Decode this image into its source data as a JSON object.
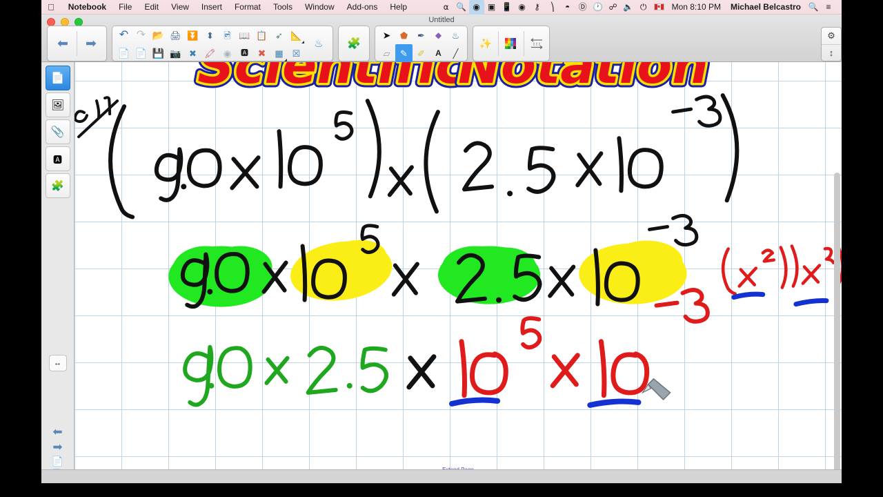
{
  "menubar": {
    "apple_icon": "apple-icon",
    "items": [
      {
        "label": "Notebook",
        "bold": true
      },
      {
        "label": "File",
        "bold": false
      },
      {
        "label": "Edit",
        "bold": false
      },
      {
        "label": "View",
        "bold": false
      },
      {
        "label": "Insert",
        "bold": false
      },
      {
        "label": "Format",
        "bold": false
      },
      {
        "label": "Tools",
        "bold": false
      },
      {
        "label": "Window",
        "bold": false
      },
      {
        "label": "Add-ons",
        "bold": false
      },
      {
        "label": "Help",
        "bold": false
      }
    ],
    "status_icons": [
      "do-not-disturb-icon",
      "spotlight-dark-icon",
      "screen-recording-icon",
      "display-icon",
      "device-sync-icon",
      "time-machine-icon",
      "airplay-audio-icon",
      "airplay-display-icon",
      "wifi-icon",
      "accessibility-icon",
      "clock-history-icon",
      "bluetooth-icon",
      "volume-icon",
      "battery-icon"
    ],
    "flag_label": "CA",
    "clock": "Mon 8:10 PM",
    "user": "Michael Belcastro",
    "search_icon": "search-icon",
    "notification_icon": "notification-center-icon"
  },
  "window": {
    "document_title": "Untitled",
    "traffic_lights": [
      "close-button",
      "minimize-button",
      "zoom-button"
    ]
  },
  "toolbar": {
    "nav": [
      {
        "name": "previous-page-button",
        "glyph": "⬅"
      },
      {
        "name": "next-page-button",
        "glyph": "➡"
      }
    ],
    "group_main_row1": [
      {
        "name": "undo-button",
        "glyph": "↶",
        "color": "#2f6fa8"
      },
      {
        "name": "redo-button",
        "glyph": "↷",
        "color": "#a8b8c4"
      },
      {
        "name": "open-file-button",
        "glyph": "📂",
        "color": "#d79a3c"
      },
      {
        "name": "insert-printer-button",
        "glyph": "🖨",
        "color": "#4a6e8f"
      },
      {
        "name": "screen-shade-button",
        "glyph": "⬜",
        "color": "#5b7f9e"
      },
      {
        "name": "page-height-button",
        "glyph": "⬍",
        "color": "#4a6e8f"
      },
      {
        "name": "screen-capture-button",
        "glyph": "🖼",
        "color": "#3c7fb1"
      },
      {
        "name": "dual-page-button",
        "glyph": "📖",
        "color": "#2f6fa8"
      },
      {
        "name": "paste-button",
        "glyph": "📋",
        "color": "#6a8199"
      },
      {
        "name": "shape-pen-button",
        "glyph": "➦",
        "color": "#55707f"
      },
      {
        "name": "measurement-tools-button",
        "glyph": "📐",
        "color": "#4a6e8f",
        "corner": true
      }
    ],
    "group_main_row2": [
      {
        "name": "add-page-button",
        "glyph": "📄",
        "color": "#3d8a3d"
      },
      {
        "name": "delete-page-button",
        "glyph": "📄",
        "color": "#c0392b"
      },
      {
        "name": "save-button",
        "glyph": "💾",
        "color": "#2f6fa8"
      },
      {
        "name": "insert-image-button",
        "glyph": "📷",
        "color": "#4a6e8f"
      },
      {
        "name": "clear-ink-button",
        "glyph": "✒",
        "color": "#3c7fb1"
      },
      {
        "name": "color-markers-button",
        "glyph": "🖍",
        "color": "#c2506a"
      },
      {
        "name": "spotlight-button",
        "glyph": "◎",
        "color": "#9aa8b2"
      },
      {
        "name": "text-align-button",
        "glyph": "🅰",
        "color": "#333333"
      },
      {
        "name": "clear-page-button",
        "glyph": "✖",
        "color": "#e0574a"
      },
      {
        "name": "insert-table-button",
        "glyph": "▦",
        "color": "#3c7fb1",
        "corner": true
      },
      {
        "name": "close-x-button",
        "glyph": "☒",
        "color": "#3c7fb1"
      }
    ],
    "group_fill": [
      {
        "name": "fill-color-button",
        "glyph": "🪣",
        "color": "#3c8fc6"
      }
    ],
    "group_addons": [
      {
        "name": "add-ons-button",
        "glyph": "🧩",
        "color": "#3c7fb1"
      }
    ],
    "group_tools_row1": [
      {
        "name": "select-tool-button",
        "glyph": "➤",
        "color": "#1a1a1a"
      },
      {
        "name": "shapes-tool-button",
        "glyph": "⬟",
        "color": "#d86a2b"
      },
      {
        "name": "pen-tool-button",
        "glyph": "✒",
        "color": "#2f4f7f"
      },
      {
        "name": "eraser-tool-button",
        "glyph": "◆",
        "color": "#8a5fb8"
      },
      {
        "name": "fill-tool-button",
        "glyph": "🪣",
        "color": "#4a6e8f"
      }
    ],
    "group_tools_row2": [
      {
        "name": "block-eraser-tool-button",
        "glyph": "▱",
        "color": "#9a9a9a"
      },
      {
        "name": "pens-tool-button",
        "glyph": "✎",
        "color": "#ffffff",
        "selected": true
      },
      {
        "name": "highlighter-tool-button",
        "glyph": "✐",
        "color": "#d4c22e"
      },
      {
        "name": "text-tool-button",
        "glyph": "A",
        "color": "#222222"
      },
      {
        "name": "line-tool-button",
        "glyph": "╱",
        "color": "#444444"
      }
    ],
    "group_style": [
      {
        "name": "magic-pen-button",
        "glyph": "✨",
        "corner": true
      },
      {
        "name": "color-palette-button",
        "glyph": "palette",
        "corner": true
      },
      {
        "name": "line-properties-button",
        "glyph": "≡",
        "corner": true
      }
    ],
    "right_controls": [
      {
        "name": "toolbar-settings-gear-button",
        "glyph": "⚙"
      },
      {
        "name": "toolbar-move-button",
        "glyph": "↕"
      }
    ]
  },
  "sidebar": {
    "tabs": [
      {
        "name": "sidebar-tab-page-sorter",
        "glyph": "📄",
        "active": true
      },
      {
        "name": "sidebar-tab-gallery",
        "glyph": "🖼",
        "active": false
      },
      {
        "name": "sidebar-tab-attachments",
        "glyph": "📎",
        "active": false
      },
      {
        "name": "sidebar-tab-properties",
        "glyph": "🅰",
        "active": false
      },
      {
        "name": "sidebar-tab-add-ons",
        "glyph": "🧩",
        "active": false
      }
    ],
    "expand_button": {
      "name": "sidebar-expand-button",
      "glyph": "↔"
    },
    "bottom_controls": [
      {
        "name": "sidebar-previous-button",
        "glyph": "⬅"
      },
      {
        "name": "sidebar-next-button",
        "glyph": "➡"
      },
      {
        "name": "sidebar-add-page-button",
        "glyph": "📄"
      },
      {
        "name": "sidebar-delete-page-button",
        "glyph": "📄"
      }
    ]
  },
  "canvas": {
    "title_text": "SCIENTIFIC NOTATION",
    "title_colors": {
      "fill": "#e8131a",
      "inner_outline": "#ffe000",
      "outer_outline": "#1b1fa8"
    },
    "example_label": "ex 1",
    "line1": "(9.0 x 10⁵) x (2.5 x 10⁻³)",
    "line2_terms": [
      {
        "text": "9.0",
        "highlight": "#22e822"
      },
      {
        "text": "x",
        "highlight": "none"
      },
      {
        "text": "10⁵",
        "highlight": "#fbee17"
      },
      {
        "text": "x",
        "highlight": "none"
      },
      {
        "text": "2.5",
        "highlight": "#22e822"
      },
      {
        "text": "x",
        "highlight": "none"
      },
      {
        "text": "10⁻³",
        "highlight": "#fbee17"
      }
    ],
    "rule_note": "(xᵃ)(xᵇ) = xᵃ⁺ᵇ",
    "line3_green": "9.0 x 2.5",
    "line3_black": "x",
    "line3_red": "10⁵ x 10⁻³",
    "ink_colors": {
      "black": "#111111",
      "green": "#1fa81f",
      "red": "#e01b1b",
      "blue": "#1432d2",
      "highlight_green": "#22e822",
      "highlight_yellow": "#fbee17",
      "grid": "#bcd4ea"
    },
    "extend_page_label": "Extend Page"
  }
}
